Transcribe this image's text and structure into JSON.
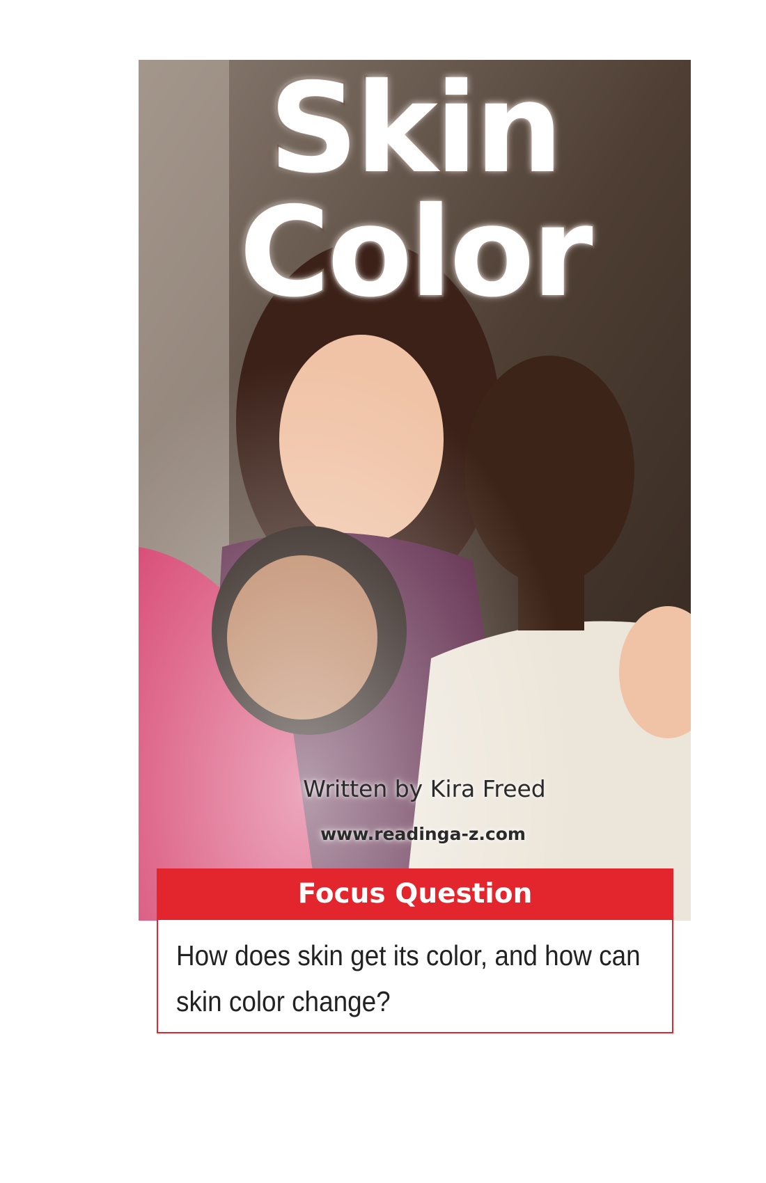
{
  "cover": {
    "title": "Skin Color",
    "author": "Written by Kira Freed",
    "website": "www.readinga-z.com",
    "photo_description_icon": "family-photo"
  },
  "focus": {
    "header": "Focus Question",
    "question": "How does skin get its color, and how can skin color change?"
  },
  "colors": {
    "focus_red": "#e3262d",
    "title_outline": "#6b5040"
  }
}
